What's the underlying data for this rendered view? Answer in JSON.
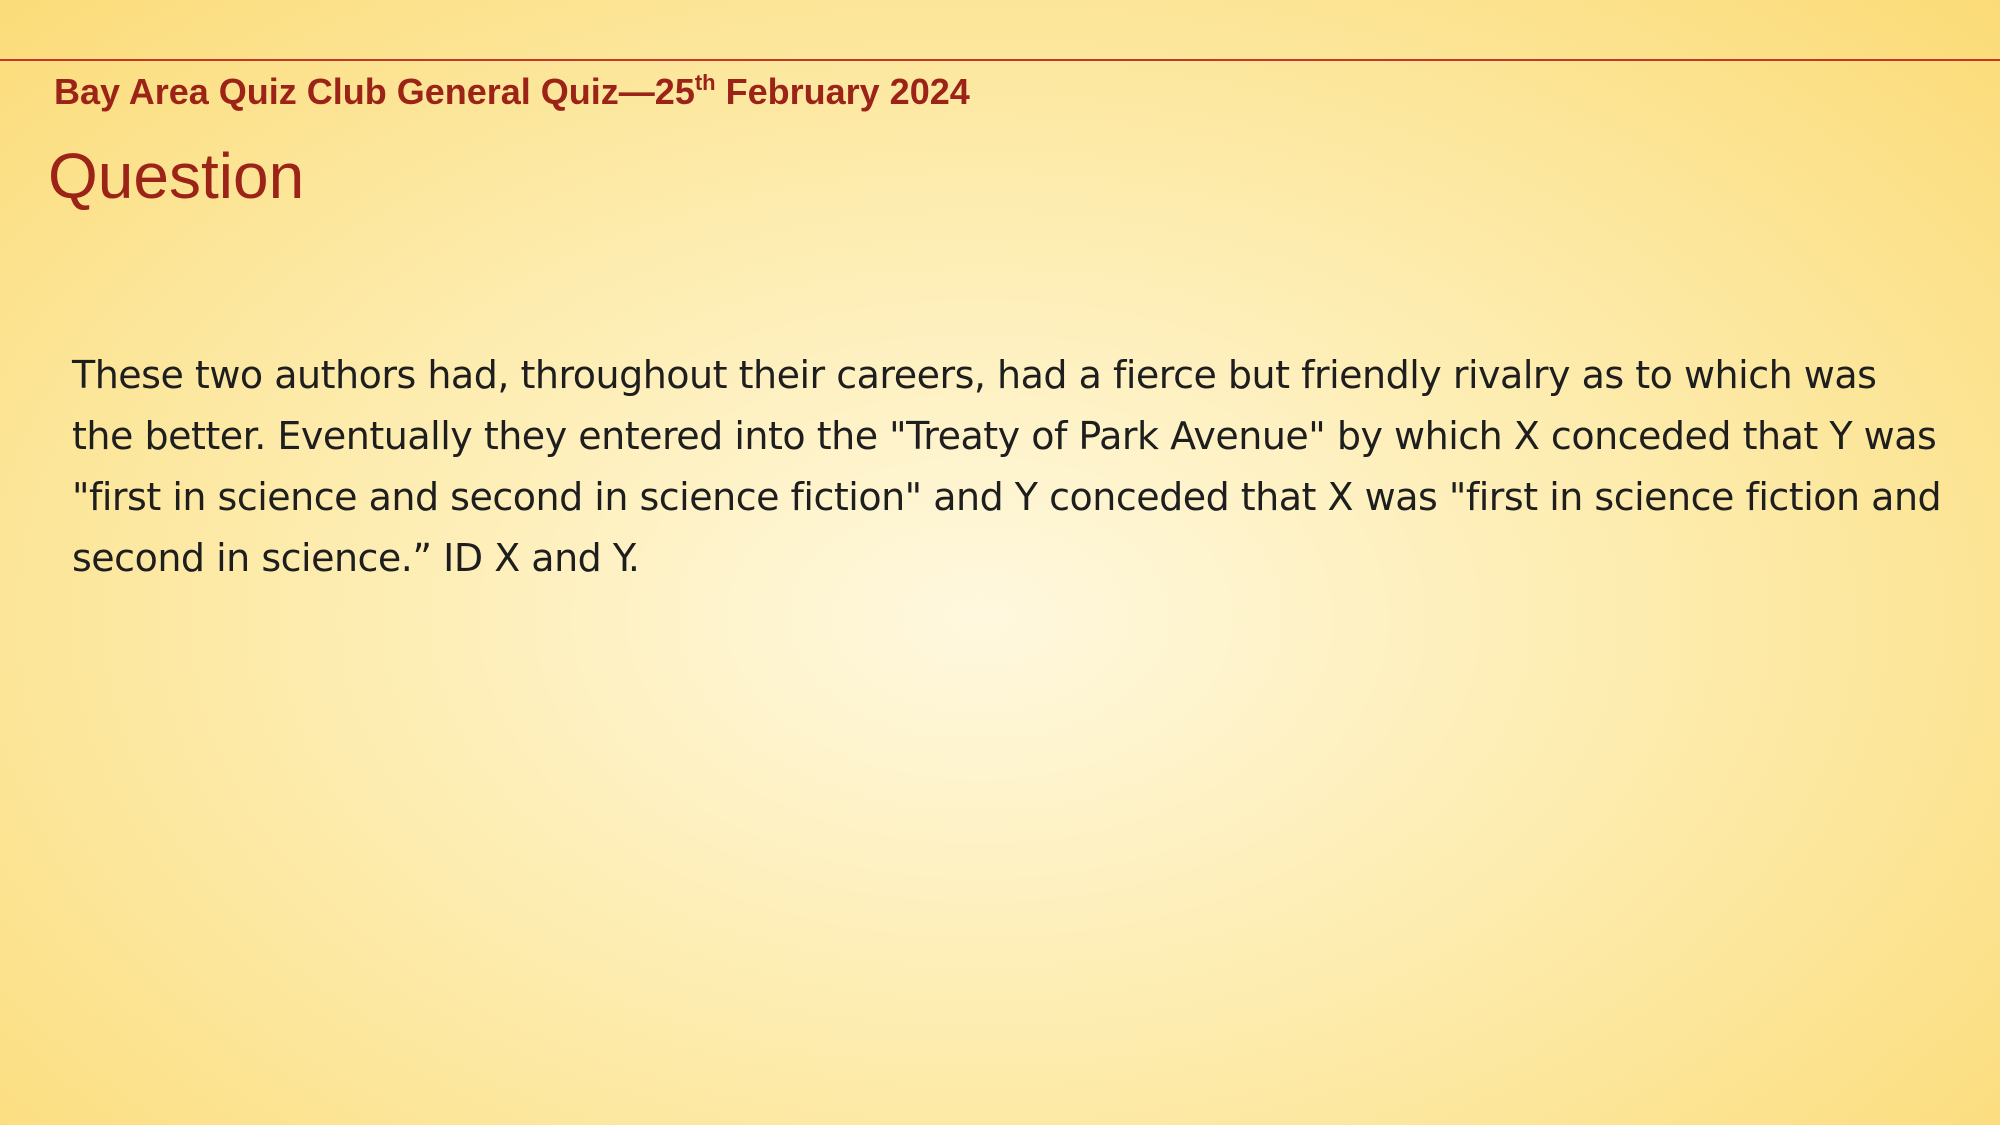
{
  "slide": {
    "header": {
      "prefix": "Bay Area Quiz Club General Quiz—25",
      "superscript": "th",
      "suffix": " February 2024"
    },
    "title": "Question",
    "question": "These two authors had, throughout their careers, had a fierce but friendly rivalry as to which was the better. Eventually they entered into the \"Treaty of Park Avenue\" by which X conceded that Y was \"first in science and second in science fiction\" and Y conceded that X was \"first in science fiction and second in science.” ID X and Y.",
    "colors": {
      "accent": "#9b2318",
      "rule": "#c0392b",
      "text": "#1e1e1e",
      "background_center": "#fff8df",
      "background_edge": "#fbd970"
    }
  }
}
